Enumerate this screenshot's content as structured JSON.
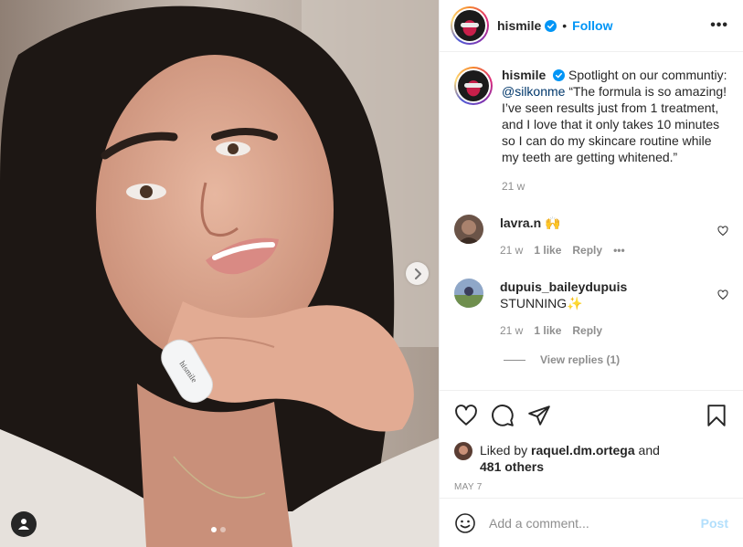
{
  "header": {
    "username": "hismile",
    "separator": "•",
    "follow_label": "Follow",
    "more_label": "•••"
  },
  "caption": {
    "username": "hismile",
    "text_before_mention": "Spotlight on our communtiy:",
    "mention": "@silkonme",
    "text_after_mention": "“The formula is so amazing! I’ve seen results just from 1 treatment, and I love that it only takes 10 minutes so I can do my skincare routine while my teeth are getting whitened.”",
    "time": "21 w"
  },
  "comments": [
    {
      "username": "lavra.n",
      "text": "🙌",
      "time": "21 w",
      "likes": "1 like",
      "reply_label": "Reply",
      "more_label": "•••"
    },
    {
      "username": "dupuis_baileydupuis",
      "text": "STUNNING✨",
      "time": "21 w",
      "likes": "1 like",
      "reply_label": "Reply"
    }
  ],
  "view_replies": "View replies (1)",
  "likes": {
    "prefix": "Liked by",
    "user": "raquel.dm.ortega",
    "and": "and",
    "others": "481 others"
  },
  "date": "MAY 7",
  "add_comment": {
    "placeholder": "Add a comment...",
    "post_label": "Post"
  },
  "product_label": "hismile",
  "icons": {
    "verified": "verified-badge-icon",
    "next": "chevron-right-icon",
    "tag": "user-tag-icon",
    "heart": "heart-icon",
    "comment": "comment-icon",
    "share": "share-icon",
    "save": "bookmark-icon",
    "emoji": "emoji-icon"
  },
  "colors": {
    "accent": "#0095f6",
    "muted": "#8e8e8e",
    "post_disabled": "#b2dffc",
    "mention": "#00376b"
  },
  "carousel": {
    "slides": 2,
    "active": 1
  }
}
